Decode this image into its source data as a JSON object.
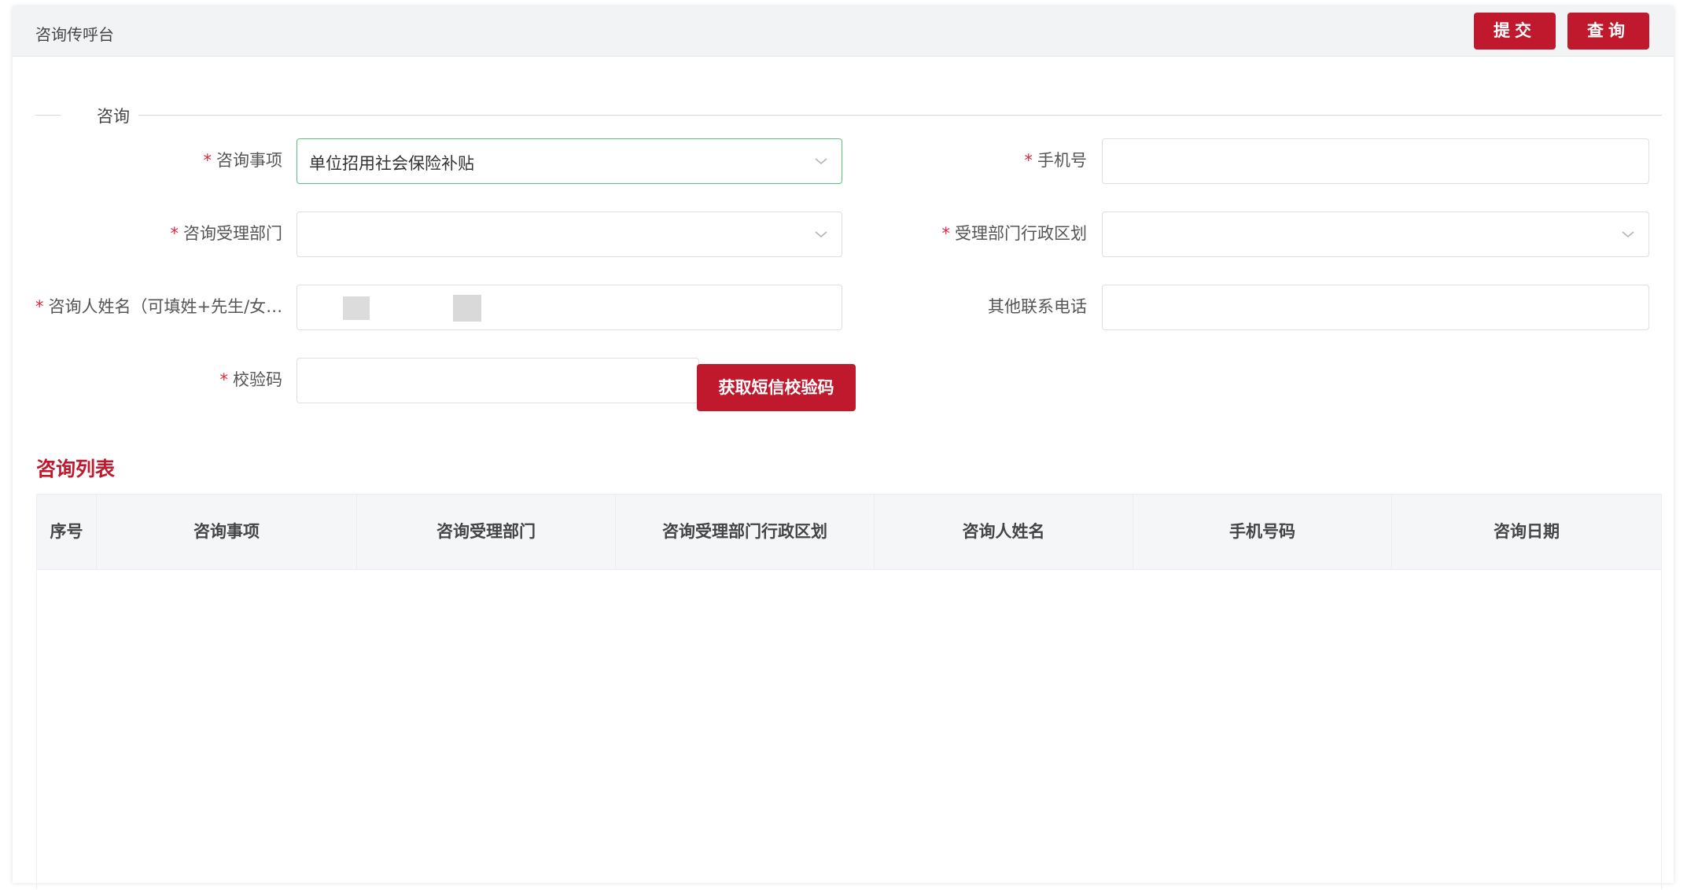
{
  "header": {
    "title": "咨询传呼台",
    "submit_label": "提交",
    "query_label": "查询"
  },
  "section": {
    "label": "咨询"
  },
  "form": {
    "consult_item": {
      "label": "咨询事项",
      "value": "单位招用社会保险补贴",
      "required": true
    },
    "phone": {
      "label": "手机号",
      "value": "",
      "required": true
    },
    "dept": {
      "label": "咨询受理部门",
      "value": "",
      "required": true
    },
    "dept_region": {
      "label": "受理部门行政区划",
      "value": "",
      "required": true
    },
    "name": {
      "label": "咨询人姓名（可填姓+先生/女…",
      "required": true
    },
    "other_phone": {
      "label": "其他联系电话",
      "value": "",
      "required": false
    },
    "code": {
      "label": "校验码",
      "value": "",
      "required": true
    },
    "sms_button_label": "获取短信校验码",
    "required_mark": "*"
  },
  "list": {
    "title": "咨询列表",
    "columns": [
      "序号",
      "咨询事项",
      "咨询受理部门",
      "咨询受理部门行政区划",
      "咨询人姓名",
      "手机号码",
      "咨询日期"
    ],
    "rows": []
  },
  "colors": {
    "accent": "#c0192e",
    "active_border": "#5cc17a"
  }
}
